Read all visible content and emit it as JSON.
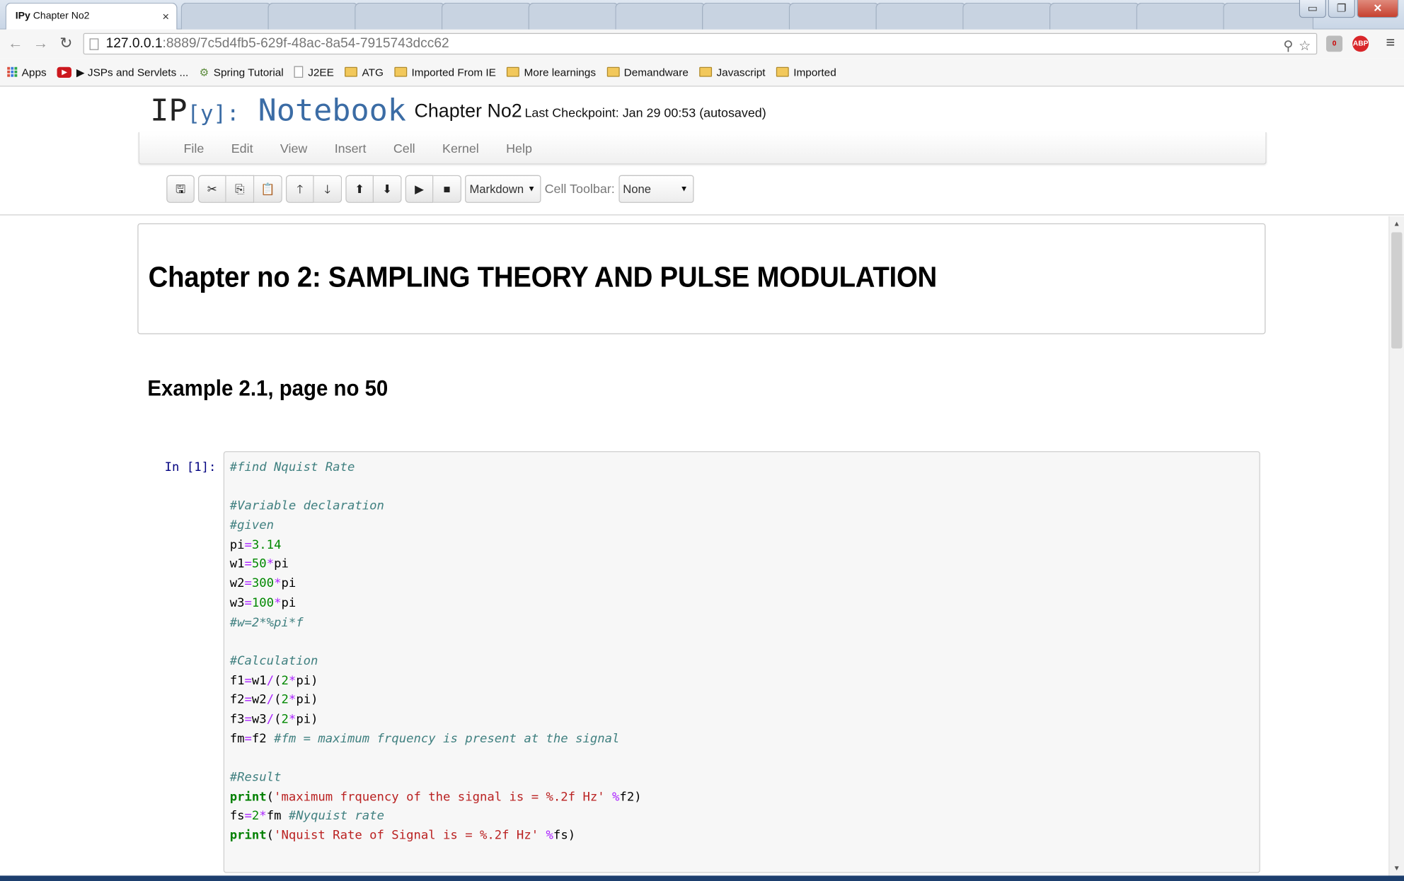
{
  "browser": {
    "active_tab": {
      "icon": "IPy",
      "title": "Chapter No2",
      "close": "×"
    },
    "inactive_tab_count": 13,
    "url_host": "127.0.0.1",
    "url_path": ":8889/7c5d4fb5-629f-48ac-8a54-7915743dcc62",
    "window_buttons": {
      "minimize": "▭",
      "maximize": "❐",
      "close": "✕"
    },
    "extensions": {
      "badge_count": "0",
      "adblock": "ABP"
    }
  },
  "bookmarks": [
    {
      "icon": "apps",
      "label": "Apps"
    },
    {
      "icon": "youtube",
      "label": "▶ JSPs and Servlets ..."
    },
    {
      "icon": "spring",
      "label": "Spring Tutorial"
    },
    {
      "icon": "page",
      "label": "J2EE"
    },
    {
      "icon": "folder",
      "label": "ATG"
    },
    {
      "icon": "folder",
      "label": "Imported From IE"
    },
    {
      "icon": "folder",
      "label": "More learnings"
    },
    {
      "icon": "folder",
      "label": "Demandware"
    },
    {
      "icon": "folder",
      "label": "Javascript"
    },
    {
      "icon": "folder",
      "label": "Imported"
    }
  ],
  "notebook": {
    "logo_ip": "IP",
    "logo_y": "[y]:",
    "logo_notebook": "Notebook",
    "title": "Chapter No2",
    "checkpoint": "Last Checkpoint: Jan 29 00:53 (autosaved)",
    "menu": [
      "File",
      "Edit",
      "View",
      "Insert",
      "Cell",
      "Kernel",
      "Help"
    ],
    "cell_type": "Markdown",
    "cell_toolbar_label": "Cell Toolbar:",
    "cell_toolbar_value": "None"
  },
  "cells": {
    "heading1": "Chapter no 2: SAMPLING THEORY AND PULSE MODULATION",
    "heading2": "Example 2.1, page no 50",
    "prompt": "In [1]:"
  },
  "code_lines": [
    [
      {
        "t": "c",
        "v": "#find Nquist Rate"
      }
    ],
    [],
    [
      {
        "t": "c",
        "v": "#Variable declaration"
      }
    ],
    [
      {
        "t": "c",
        "v": "#given"
      }
    ],
    [
      {
        "t": "",
        "v": "pi"
      },
      {
        "t": "o",
        "v": "="
      },
      {
        "t": "n",
        "v": "3.14"
      }
    ],
    [
      {
        "t": "",
        "v": "w1"
      },
      {
        "t": "o",
        "v": "="
      },
      {
        "t": "n",
        "v": "50"
      },
      {
        "t": "o",
        "v": "*"
      },
      {
        "t": "",
        "v": "pi"
      }
    ],
    [
      {
        "t": "",
        "v": "w2"
      },
      {
        "t": "o",
        "v": "="
      },
      {
        "t": "n",
        "v": "300"
      },
      {
        "t": "o",
        "v": "*"
      },
      {
        "t": "",
        "v": "pi"
      }
    ],
    [
      {
        "t": "",
        "v": "w3"
      },
      {
        "t": "o",
        "v": "="
      },
      {
        "t": "n",
        "v": "100"
      },
      {
        "t": "o",
        "v": "*"
      },
      {
        "t": "",
        "v": "pi"
      }
    ],
    [
      {
        "t": "c",
        "v": "#w=2*%pi*f"
      }
    ],
    [],
    [
      {
        "t": "c",
        "v": "#Calculation"
      }
    ],
    [
      {
        "t": "",
        "v": "f1"
      },
      {
        "t": "o",
        "v": "="
      },
      {
        "t": "",
        "v": "w1"
      },
      {
        "t": "o",
        "v": "/"
      },
      {
        "t": "",
        "v": "("
      },
      {
        "t": "n",
        "v": "2"
      },
      {
        "t": "o",
        "v": "*"
      },
      {
        "t": "",
        "v": "pi)"
      }
    ],
    [
      {
        "t": "",
        "v": "f2"
      },
      {
        "t": "o",
        "v": "="
      },
      {
        "t": "",
        "v": "w2"
      },
      {
        "t": "o",
        "v": "/"
      },
      {
        "t": "",
        "v": "("
      },
      {
        "t": "n",
        "v": "2"
      },
      {
        "t": "o",
        "v": "*"
      },
      {
        "t": "",
        "v": "pi)"
      }
    ],
    [
      {
        "t": "",
        "v": "f3"
      },
      {
        "t": "o",
        "v": "="
      },
      {
        "t": "",
        "v": "w3"
      },
      {
        "t": "o",
        "v": "/"
      },
      {
        "t": "",
        "v": "("
      },
      {
        "t": "n",
        "v": "2"
      },
      {
        "t": "o",
        "v": "*"
      },
      {
        "t": "",
        "v": "pi)"
      }
    ],
    [
      {
        "t": "",
        "v": "fm"
      },
      {
        "t": "o",
        "v": "="
      },
      {
        "t": "",
        "v": "f2 "
      },
      {
        "t": "c",
        "v": "#fm = maximum frquency is present at the signal"
      }
    ],
    [],
    [
      {
        "t": "c",
        "v": "#Result"
      }
    ],
    [
      {
        "t": "k",
        "v": "print"
      },
      {
        "t": "",
        "v": "("
      },
      {
        "t": "s",
        "v": "'maximum frquency of the signal is = %.2f Hz'"
      },
      {
        "t": "",
        "v": " "
      },
      {
        "t": "o",
        "v": "%"
      },
      {
        "t": "",
        "v": "f2)"
      }
    ],
    [
      {
        "t": "",
        "v": "fs"
      },
      {
        "t": "o",
        "v": "="
      },
      {
        "t": "n",
        "v": "2"
      },
      {
        "t": "o",
        "v": "*"
      },
      {
        "t": "",
        "v": "fm "
      },
      {
        "t": "c",
        "v": "#Nyquist rate"
      }
    ],
    [
      {
        "t": "k",
        "v": "print"
      },
      {
        "t": "",
        "v": "("
      },
      {
        "t": "s",
        "v": "'Nquist Rate of Signal is = %.2f Hz'"
      },
      {
        "t": "",
        "v": " "
      },
      {
        "t": "o",
        "v": "%"
      },
      {
        "t": "",
        "v": "fs)"
      }
    ]
  ],
  "colors": {
    "comment": "#408080",
    "number": "#008800",
    "operator": "#aa22ff",
    "string": "#ba2121",
    "keyword": "#008000",
    "logo_blue": "#3b6ca5",
    "prompt_blue": "#000080"
  }
}
